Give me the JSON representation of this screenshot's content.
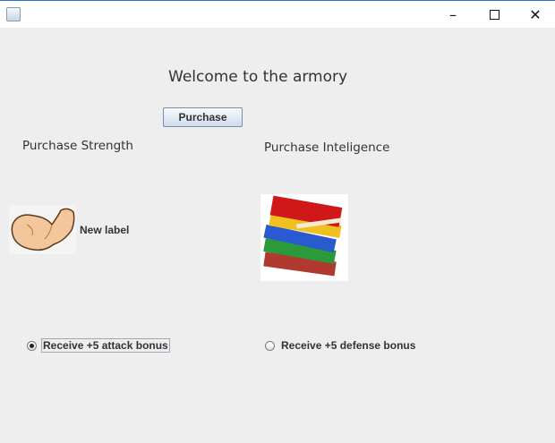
{
  "window": {
    "minimize_icon": "minimize-icon",
    "maximize_icon": "maximize-icon",
    "close_icon": "close-icon"
  },
  "main": {
    "welcome": "Welcome to the armory",
    "purchase_button": "Purchase",
    "strength_heading": "Purchase Strength",
    "intelligence_heading": "Purchase Inteligence",
    "new_label": "New label",
    "attack_option": {
      "label": "Receive +5 attack bonus",
      "selected": true
    },
    "defense_option": {
      "label": "Receive +5 defense bonus",
      "selected": false
    }
  }
}
